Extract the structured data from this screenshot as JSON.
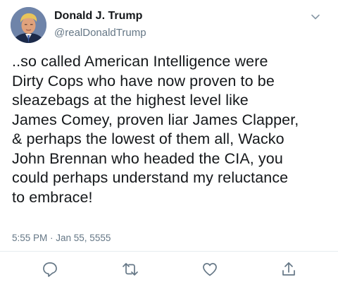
{
  "header": {
    "display_name": "Donald J. Trump",
    "handle": "@realDonaldTrump",
    "menu_icon": "chevron-down-icon",
    "avatar_icon": "avatar"
  },
  "tweet": {
    "text": "..so called American Intelligence were\nDirty Cops who have now proven to be\nsleazebags at the highest level like\nJames Comey, proven liar James Clapper,\n& perhaps the lowest of them all, Wacko\nJohn Brennan who headed the CIA, you\ncould perhaps understand my reluctance\nto embrace!",
    "timestamp": "5:55 PM · Jan 55, 5555"
  },
  "actions": [
    {
      "name": "reply",
      "icon": "reply-icon"
    },
    {
      "name": "retweet",
      "icon": "retweet-icon"
    },
    {
      "name": "like",
      "icon": "heart-icon"
    },
    {
      "name": "share",
      "icon": "share-icon"
    }
  ],
  "colors": {
    "primary_text": "#14171a",
    "secondary_text": "#657786",
    "icon": "#657786",
    "divider": "#e6ecf0"
  }
}
